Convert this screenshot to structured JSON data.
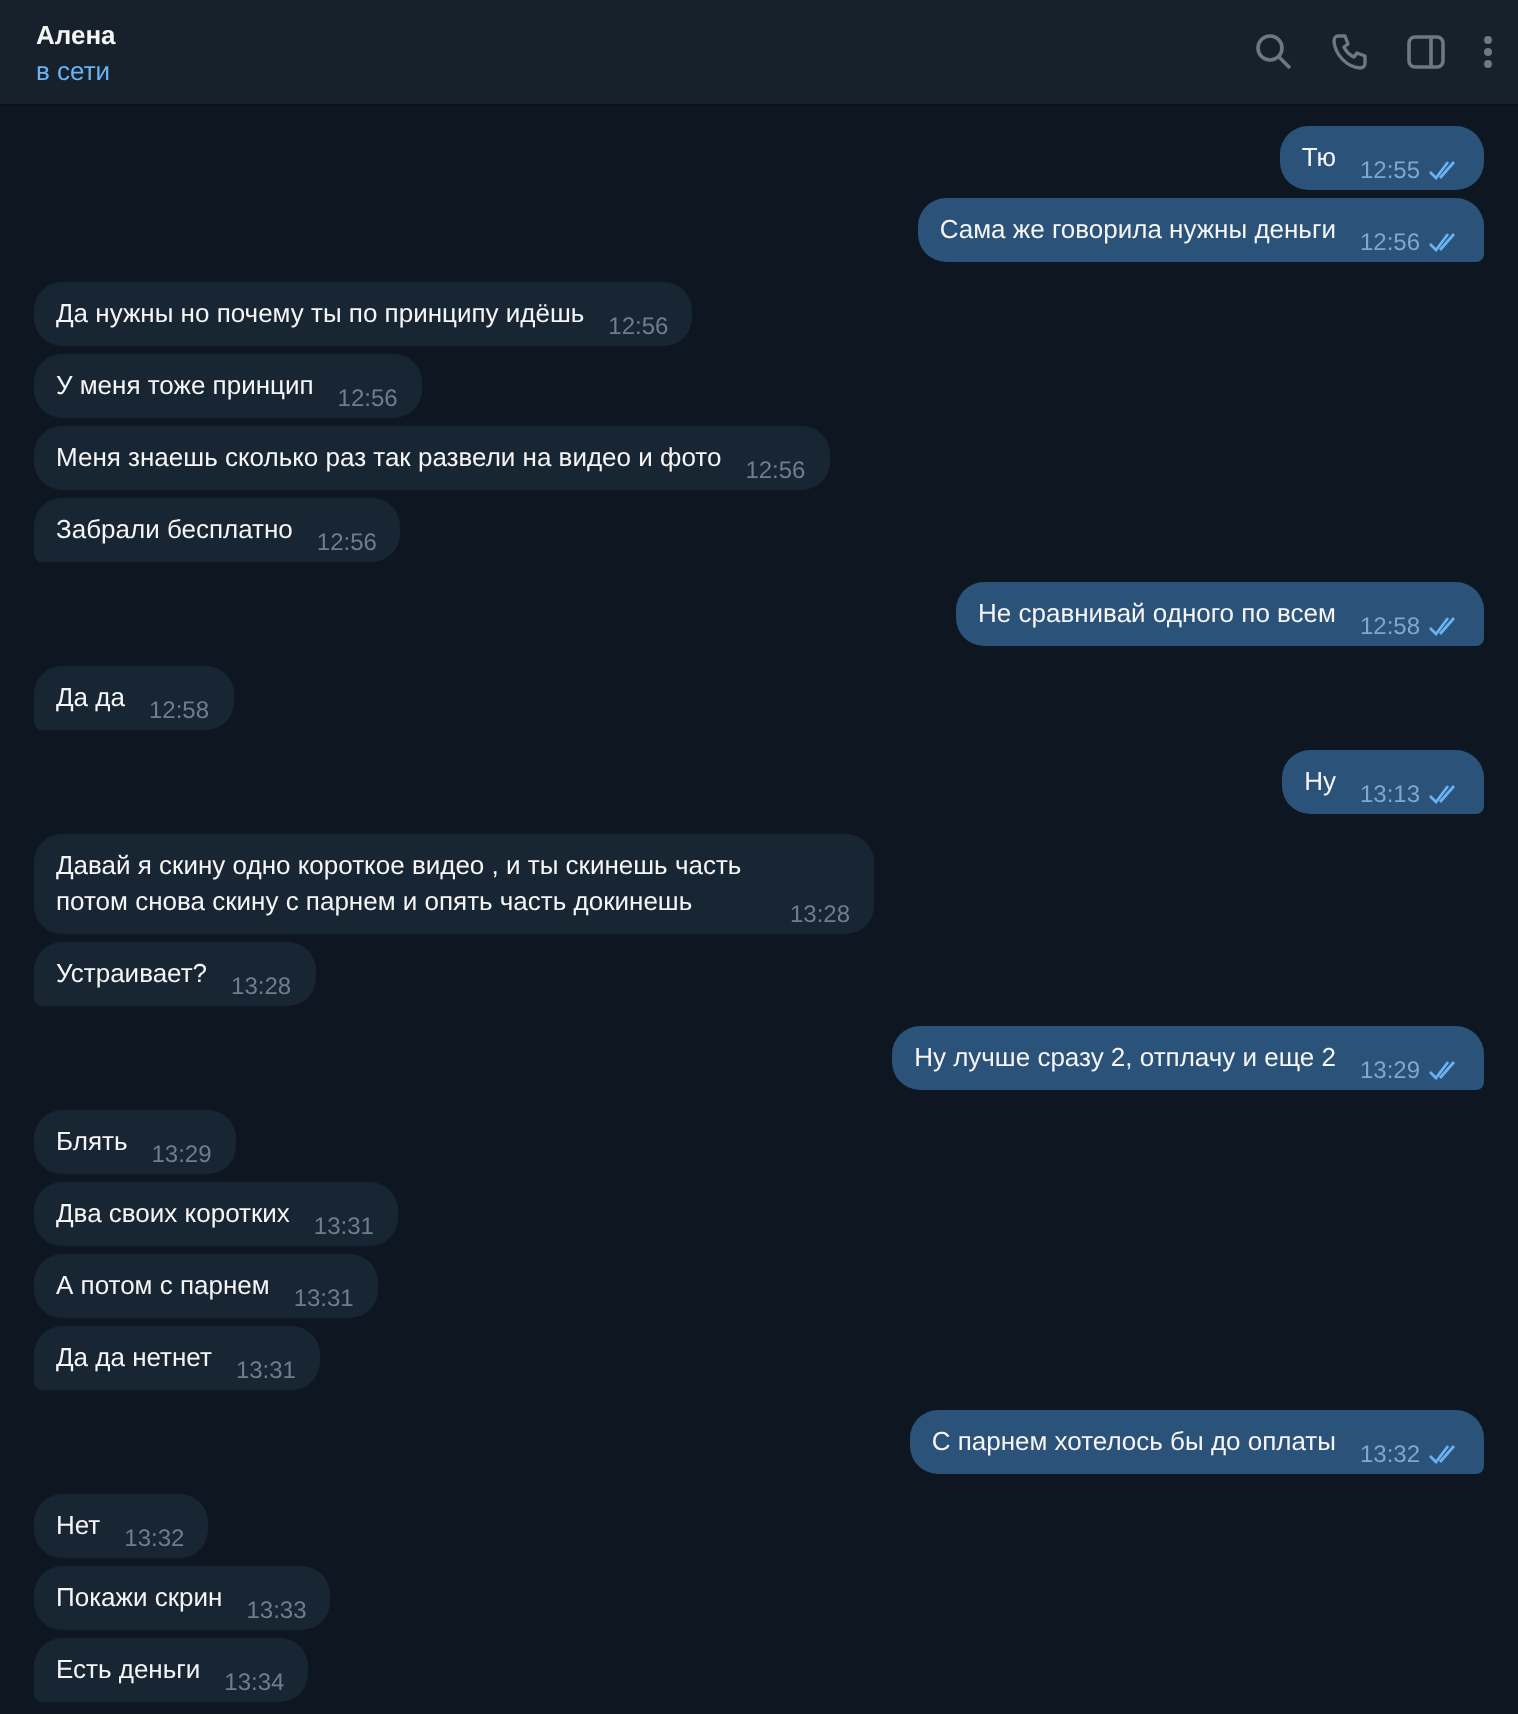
{
  "header": {
    "name": "Алена",
    "status": "в сети"
  },
  "groups": [
    {
      "outgoing": true,
      "messages": [
        {
          "text": "Тю",
          "time": "12:55",
          "read": true
        },
        {
          "text": "Сама же говорила нужны деньги",
          "time": "12:56",
          "read": true
        }
      ]
    },
    {
      "outgoing": false,
      "messages": [
        {
          "text": "Да нужны но почему ты по принципу идёшь",
          "time": "12:56"
        },
        {
          "text": "У меня тоже принцип",
          "time": "12:56"
        },
        {
          "text": "Меня знаешь сколько раз так развели на видео и фото",
          "time": "12:56"
        },
        {
          "text": "Забрали бесплатно",
          "time": "12:56"
        }
      ]
    },
    {
      "outgoing": true,
      "messages": [
        {
          "text": "Не сравнивай одного по всем",
          "time": "12:58",
          "read": true
        }
      ]
    },
    {
      "outgoing": false,
      "messages": [
        {
          "text": "Да да",
          "time": "12:58"
        }
      ]
    },
    {
      "outgoing": true,
      "messages": [
        {
          "text": "Ну",
          "time": "13:13",
          "read": true
        }
      ]
    },
    {
      "outgoing": false,
      "messages": [
        {
          "text": "Давай я скину одно короткое видео , и ты скинешь часть потом снова скину с парнем и опять часть докинешь",
          "time": "13:28"
        },
        {
          "text": "Устраивает?",
          "time": "13:28"
        }
      ]
    },
    {
      "outgoing": true,
      "messages": [
        {
          "text": "Ну лучше сразу 2, отплачу и еще 2",
          "time": "13:29",
          "read": true
        }
      ]
    },
    {
      "outgoing": false,
      "messages": [
        {
          "text": "Блять",
          "time": "13:29"
        },
        {
          "text": "Два своих коротких",
          "time": "13:31"
        },
        {
          "text": "А потом с парнем",
          "time": "13:31"
        },
        {
          "text": "Да да нетнет",
          "time": "13:31"
        }
      ]
    },
    {
      "outgoing": true,
      "messages": [
        {
          "text": "С парнем хотелось бы до оплаты",
          "time": "13:32",
          "read": true
        }
      ]
    },
    {
      "outgoing": false,
      "messages": [
        {
          "text": "Нет",
          "time": "13:32"
        },
        {
          "text": "Покажи скрин",
          "time": "13:33"
        },
        {
          "text": "Есть деньги",
          "time": "13:34"
        }
      ]
    }
  ]
}
